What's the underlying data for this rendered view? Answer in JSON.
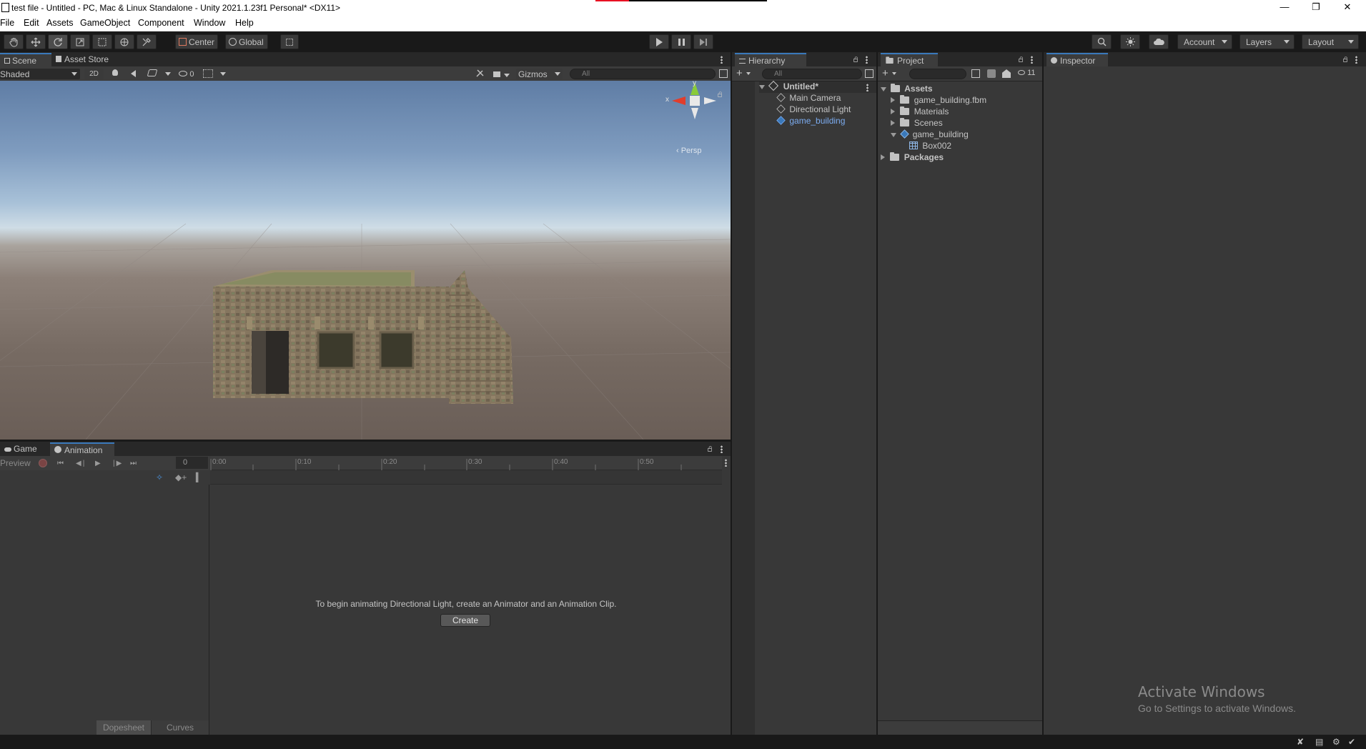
{
  "window": {
    "title": "test file - Untitled - PC, Mac & Linux Standalone - Unity 2021.1.23f1 Personal* <DX11>",
    "controls": [
      "minimize-icon",
      "restore-icon",
      "close-icon"
    ]
  },
  "menu": [
    "File",
    "Edit",
    "Assets",
    "GameObject",
    "Component",
    "Window",
    "Help"
  ],
  "toolbar": {
    "tools": [
      "hand-icon",
      "move-icon",
      "rotate-icon",
      "scale-icon",
      "rect-icon",
      "transform-icon",
      "custom-tool-icon"
    ],
    "pivot_label": "Center",
    "space_label": "Global",
    "account_label": "Account",
    "layers_label": "Layers",
    "layout_label": "Layout"
  },
  "scene": {
    "tabs": [
      "Scene",
      "Asset Store"
    ],
    "shading_mode": "Shaded",
    "mode_2d": "2D",
    "hidden_count": "0",
    "gizmos_label": "Gizmos",
    "search_placeholder": "All",
    "gizmo_axes": {
      "x": "x",
      "y": "y"
    },
    "persp_label": "‹ Persp"
  },
  "hierarchy": {
    "tab": "Hierarchy",
    "search_placeholder": "All",
    "scene_name": "Untitled*",
    "items": [
      "Main Camera",
      "Directional Light",
      "game_building"
    ]
  },
  "project": {
    "tab": "Project",
    "badge_count": "11",
    "assets_label": "Assets",
    "items": [
      "game_building.fbm",
      "Materials",
      "Scenes",
      "game_building"
    ],
    "sub_items": [
      "Box002"
    ],
    "packages_label": "Packages"
  },
  "inspector": {
    "tab": "Inspector",
    "watermark_title": "Activate Windows",
    "watermark_sub": "Go to Settings to activate Windows."
  },
  "animation": {
    "tabs": [
      "Game",
      "Animation"
    ],
    "preview_label": "Preview",
    "frame_value": "0",
    "ruler_ticks": [
      "0:00",
      "0:10",
      "0:20",
      "0:30",
      "0:40",
      "0:50"
    ],
    "message": "To begin animating Directional Light, create an Animator and an Animation Clip.",
    "create_label": "Create",
    "bottom_tabs": [
      "Dopesheet",
      "Curves"
    ]
  },
  "colors": {
    "accent": "#3a79bb",
    "selected_text": "#7cacf0",
    "panel_bg": "#383838",
    "dark_bg": "#191919"
  }
}
